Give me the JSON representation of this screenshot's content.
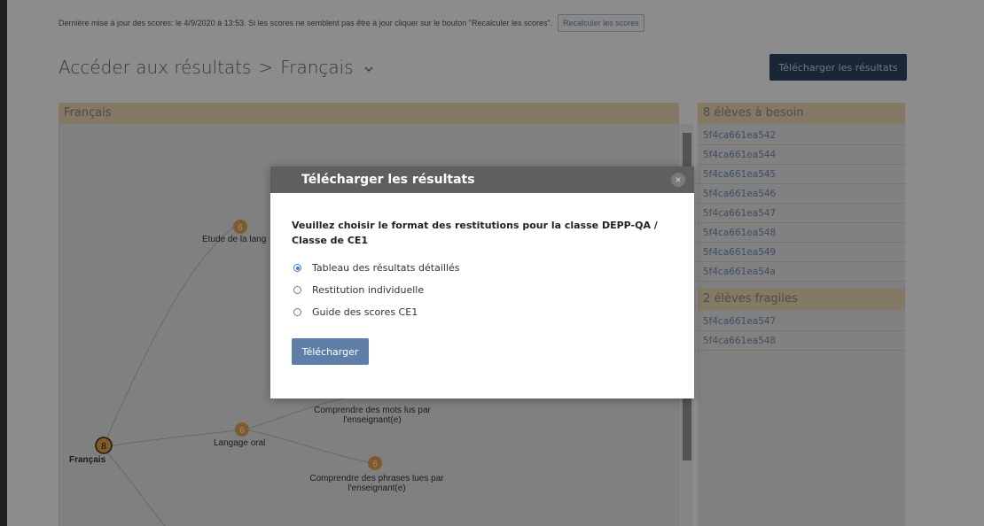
{
  "status": {
    "text": "Dernière mise à jour des scores: le 4/9/2020 à 13:53. Si les scores ne semblent pas être à jour cliquer sur le bouton \"Recalculer les scores\".",
    "recalc_label": "Recalculer les scores"
  },
  "header": {
    "breadcrumb_root": "Accéder aux résultats",
    "separator": ">",
    "subject": "Français",
    "download_label": "Télécharger les résultats"
  },
  "panel": {
    "title": "Français",
    "nodes": [
      {
        "count": "8",
        "label": "Français"
      },
      {
        "count": "6",
        "label": "Etude de la lang"
      },
      {
        "count": "6",
        "label": "Langage oral"
      },
      {
        "count": "",
        "label": "Comprendre des mots lus par l'enseignant(e)"
      },
      {
        "count": "6",
        "label": "Comprendre des phrases lues par l'enseignant(e)"
      }
    ]
  },
  "side": {
    "need_title": "8 élèves à besoin",
    "need_items": [
      "5f4ca661ea542",
      "5f4ca661ea544",
      "5f4ca661ea545",
      "5f4ca661ea546",
      "5f4ca661ea547",
      "5f4ca661ea548",
      "5f4ca661ea549",
      "5f4ca661ea54a"
    ],
    "fragile_title": "2 élèves fragiles",
    "fragile_items": [
      "5f4ca661ea547",
      "5f4ca661ea548"
    ]
  },
  "modal": {
    "title": "Télécharger les résultats",
    "close_glyph": "×",
    "question": "Veuillez choisir le format des restitutions pour la classe DEPP-QA / Classe de CE1",
    "options": [
      {
        "label": "Tableau des résultats détaillés",
        "checked": true
      },
      {
        "label": "Restitution individuelle",
        "checked": false
      },
      {
        "label": "Guide des scores CE1",
        "checked": false
      }
    ],
    "download_label": "Télécharger"
  },
  "colors": {
    "accent": "#5f7fa8",
    "dark_button": "#2f4661",
    "panel_header": "#efdcb6",
    "node_orange": "#e9a54f",
    "link": "#6f8eae"
  }
}
